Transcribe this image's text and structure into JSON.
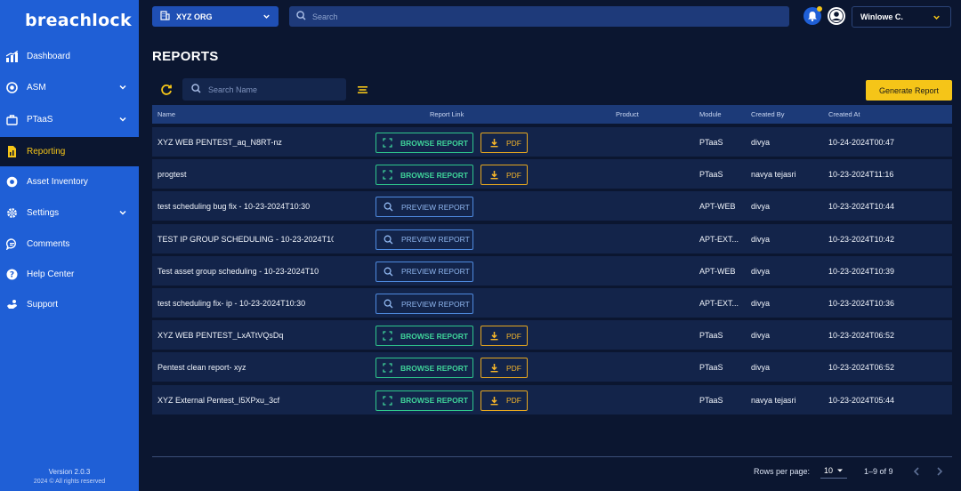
{
  "app": {
    "logo": "breachlock"
  },
  "sidebar": {
    "items": [
      {
        "label": "Dashboard",
        "icon": "bar-chart-icon"
      },
      {
        "label": "ASM",
        "icon": "target-icon"
      },
      {
        "label": "PTaaS",
        "icon": "briefcase-icon"
      },
      {
        "label": "Reporting",
        "icon": "report-icon",
        "active": true
      },
      {
        "label": "Asset Inventory",
        "icon": "inventory-icon"
      },
      {
        "label": "Settings",
        "icon": "gear-icon"
      },
      {
        "label": "Comments",
        "icon": "comment-icon"
      },
      {
        "label": "Help Center",
        "icon": "help-icon"
      },
      {
        "label": "Support",
        "icon": "support-icon"
      }
    ],
    "version": "Version 2.0.3",
    "copyright": "2024 © All rights reserved"
  },
  "topbar": {
    "org": "XYZ ORG",
    "search_placeholder": "Search",
    "user": "Winlowe C."
  },
  "page": {
    "title": "REPORTS",
    "search_placeholder": "Search Name",
    "generate_label": "Generate Report"
  },
  "table": {
    "headers": {
      "name": "Name",
      "report_link": "Report Link",
      "product": "Product",
      "module": "Module",
      "created_by": "Created By",
      "created_at": "Created At"
    },
    "browse_label": "BROWSE REPORT",
    "pdf_label": "PDF",
    "preview_label": "PREVIEW REPORT",
    "rows": [
      {
        "name": "XYZ WEB PENTEST_aq_N8RT-nz",
        "link": "browse",
        "module": "PTaaS",
        "created_by": "divya",
        "created_at": "10-24-2024T00:47"
      },
      {
        "name": "progtest",
        "link": "browse",
        "module": "PTaaS",
        "created_by": "navya tejasri",
        "created_at": "10-23-2024T11:16"
      },
      {
        "name": "test scheduling bug fix - 10-23-2024T10:30",
        "link": "preview",
        "module": "APT-WEB",
        "created_by": "divya",
        "created_at": "10-23-2024T10:44"
      },
      {
        "name": "TEST IP GROUP SCHEDULING - 10-23-2024T10:3",
        "link": "preview",
        "module": "APT-EXT...",
        "created_by": "divya",
        "created_at": "10-23-2024T10:42"
      },
      {
        "name": "Test asset group scheduling - 10-23-2024T10",
        "link": "preview",
        "module": "APT-WEB",
        "created_by": "divya",
        "created_at": "10-23-2024T10:39"
      },
      {
        "name": "test scheduling fix- ip - 10-23-2024T10:30",
        "link": "preview",
        "module": "APT-EXT...",
        "created_by": "divya",
        "created_at": "10-23-2024T10:36"
      },
      {
        "name": "XYZ WEB PENTEST_LxATtVQsDq",
        "link": "browse",
        "module": "PTaaS",
        "created_by": "divya",
        "created_at": "10-23-2024T06:52"
      },
      {
        "name": "Pentest clean report- xyz",
        "link": "browse",
        "module": "PTaaS",
        "created_by": "divya",
        "created_at": "10-23-2024T06:52"
      },
      {
        "name": "XYZ External Pentest_I5XPxu_3cf",
        "link": "browse",
        "module": "PTaaS",
        "created_by": "navya tejasri",
        "created_at": "10-23-2024T05:44"
      }
    ]
  },
  "pagination": {
    "rows_per_page_label": "Rows per page:",
    "rows_per_page": "10",
    "range": "1–9 of 9"
  },
  "colors": {
    "sidebar": "#1f5fd6",
    "background": "#0b1630",
    "accent_yellow": "#f5c518",
    "browse_green": "#2fc88d",
    "pdf_orange": "#e8a81f",
    "preview_blue": "#4f8be0"
  }
}
